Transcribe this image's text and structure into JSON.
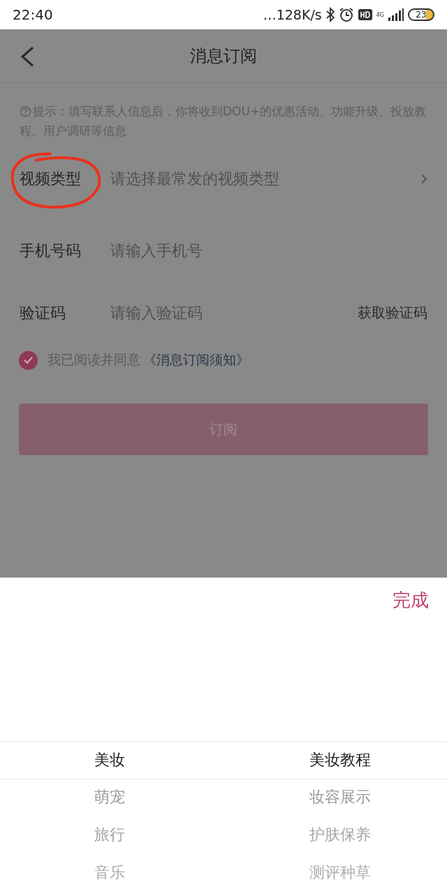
{
  "status_bar": {
    "time": "22:40",
    "network_speed": "…128K/s",
    "network_type": "4G",
    "battery": "23"
  },
  "nav": {
    "title": "消息订阅"
  },
  "hint": "提示：填写联系人信息后，你将收到DOU+的优惠活动、功能升级、投放教程、用户调研等信息",
  "form": [
    {
      "kind": "select",
      "label": "视频类型",
      "placeholder": "请选择最常发的视频类型"
    },
    {
      "kind": "input",
      "label": "手机号码",
      "placeholder": "请输入手机号"
    },
    {
      "kind": "code",
      "label": "验证码",
      "placeholder": "请输入验证码",
      "action": "获取验证码"
    }
  ],
  "agreement": {
    "checked": true,
    "text": "我已阅读并同意",
    "link": "《消息订阅须知》"
  },
  "submit": {
    "label": "订阅",
    "disabled": true
  },
  "picker": {
    "done": "完成",
    "columns": [
      {
        "items": [
          {
            "label": "美妆",
            "selected": true
          },
          {
            "label": "萌宠",
            "selected": false
          },
          {
            "label": "旅行",
            "selected": false
          },
          {
            "label": "音乐",
            "selected": false
          }
        ]
      },
      {
        "items": [
          {
            "label": "美妆教程",
            "selected": true
          },
          {
            "label": "妆容展示",
            "selected": false
          },
          {
            "label": "护肤保养",
            "selected": false
          },
          {
            "label": "测评种草",
            "selected": false
          }
        ]
      }
    ]
  }
}
